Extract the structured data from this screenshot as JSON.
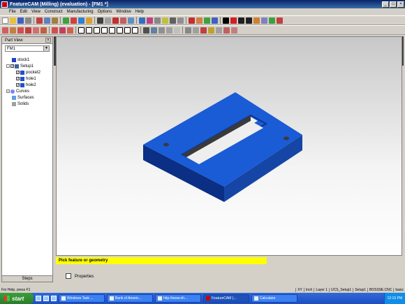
{
  "window": {
    "title": "FeatureCAM (Milling) (evaluation) - [FM1 *]"
  },
  "menu": [
    "File",
    "Edit",
    "View",
    "Construct",
    "Manufacturing",
    "Options",
    "Window",
    "Help"
  ],
  "part_view": {
    "header": "Part View",
    "combo_value": "FM1",
    "tree": [
      {
        "label": "stock1"
      },
      {
        "label": "Setup1"
      },
      {
        "label": "pocket2"
      },
      {
        "label": "hole1"
      },
      {
        "label": "hole2"
      },
      {
        "label": "Curves"
      },
      {
        "label": "Surfaces"
      },
      {
        "label": "Solids"
      }
    ],
    "steps_label": "Steps"
  },
  "prompt": "Pick feature or geometry",
  "properties_label": "Properties",
  "status": {
    "help": "For Help, press F1",
    "cells": [
      "XY",
      "Inch",
      "Layer 1",
      "UCS_Setup1",
      "Setup1",
      "BOSS9E.CNC",
      "basic"
    ]
  },
  "taskbar": {
    "start": "start",
    "tasks": [
      "Windows Task ...",
      "Bank of Americ...",
      "http://www.nh...",
      "FeatureCAM (...",
      "Calculator"
    ],
    "tray_text": "12:15 PM"
  },
  "colors": {
    "part_top": "#1a5bd6",
    "part_side_dark": "#0b2f85",
    "part_side_mid": "#1546a6",
    "prompt": "#ffff00"
  }
}
